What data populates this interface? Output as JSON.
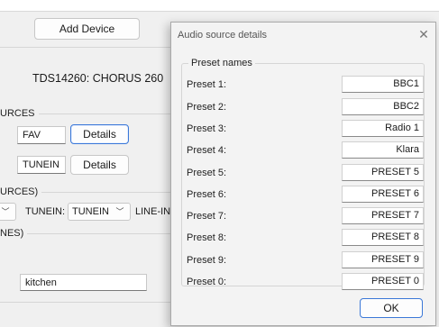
{
  "main": {
    "add_device_label": "Add Device",
    "device_title": "TDS14260: CHORUS 260",
    "group_sources": "URCES",
    "fav_value": "FAV",
    "details1_label": "Details",
    "tunein_value": "TUNEIN",
    "details2_label": "Details",
    "group_sources2": "URCES)",
    "tunein_label": "TUNEIN:",
    "tunein_select": "TUNEIN",
    "linein_label": "LINE-IN:",
    "group_names": "NES)",
    "room_value": "kitchen"
  },
  "dialog": {
    "title": "Audio source details",
    "close_glyph": "✕",
    "group_label": "Preset names",
    "presets": [
      {
        "label": "Preset 1:",
        "value": "BBC1"
      },
      {
        "label": "Preset 2:",
        "value": "BBC2"
      },
      {
        "label": "Preset 3:",
        "value": "Radio 1"
      },
      {
        "label": "Preset 4:",
        "value": "Klara"
      },
      {
        "label": "Preset 5:",
        "value": "PRESET 5"
      },
      {
        "label": "Preset 6:",
        "value": "PRESET 6"
      },
      {
        "label": "Preset 7:",
        "value": "PRESET 7"
      },
      {
        "label": "Preset 8:",
        "value": "PRESET 8"
      },
      {
        "label": "Preset 9:",
        "value": "PRESET 9"
      },
      {
        "label": "Preset 0:",
        "value": "PRESET 0"
      }
    ],
    "ok_label": "OK"
  },
  "icons": {
    "chevron": "chevron-down-icon",
    "close": "close-icon"
  }
}
